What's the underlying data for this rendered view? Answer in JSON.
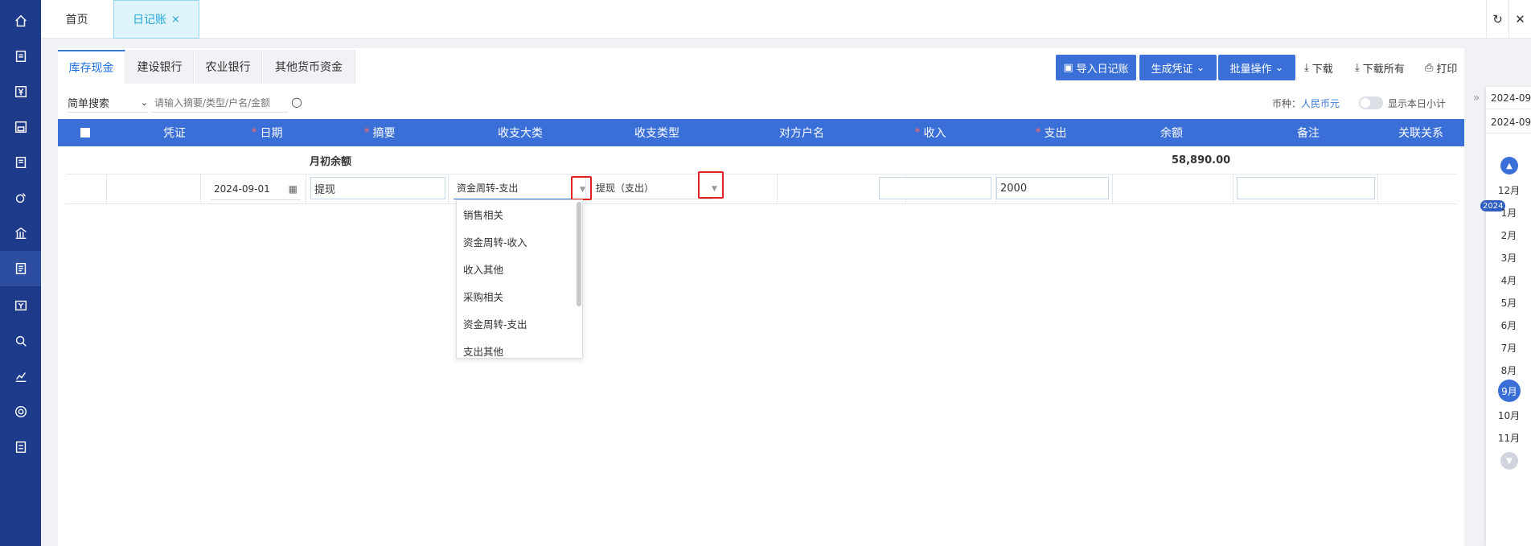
{
  "sidebar": {
    "icons": [
      "home-icon",
      "edit-icon",
      "yen-icon",
      "save-icon",
      "book-icon",
      "money-bag-icon",
      "building-icon",
      "ledger-icon",
      "invoice-icon",
      "search-user-icon",
      "chart-icon",
      "gear-icon",
      "report-icon"
    ]
  },
  "topbar": {
    "home": "首页",
    "diary": "日记账",
    "close": "×",
    "refresh": "↻",
    "close_all": "✕"
  },
  "bank_tabs": [
    "库存现金",
    "建设银行",
    "农业银行",
    "其他货币资金"
  ],
  "toolbar": {
    "import": "导入日记账",
    "voucher": "生成凭证",
    "batch": "批量操作",
    "download": "下载",
    "download_all": "下载所有",
    "print": "打印"
  },
  "search": {
    "mode": "简单搜索",
    "placeholder": "请输入摘要/类型/户名/金额"
  },
  "currency": {
    "label": "币种：",
    "value": "人民币元"
  },
  "toggle_label": "显示本日小计",
  "columns": [
    "凭证",
    "日期",
    "摘要",
    "收支大类",
    "收支类型",
    "对方户名",
    "收入",
    "支出",
    "余额",
    "备注",
    "关联关系"
  ],
  "required_mark": "*",
  "opening_row": {
    "label": "月初余额",
    "balance": "58,890.00"
  },
  "edit_row": {
    "date": "2024-09-01",
    "summary": "提现",
    "category": "资金周转-支出",
    "type": "提现（支出）",
    "counterparty": "",
    "income": "",
    "expense": "2000",
    "note": ""
  },
  "dropdown_options": [
    "销售相关",
    "资金周转-收入",
    "收入其他",
    "采购相关",
    "资金周转-支出",
    "支出其他"
  ],
  "right_panel": {
    "year_from": "2024-09",
    "year_to": "2024-09",
    "months": [
      "12月",
      "1月",
      "2月",
      "3月",
      "4月",
      "5月",
      "6月",
      "7月",
      "8月",
      "9月",
      "10月",
      "11月"
    ],
    "year_badge": "2024",
    "active_month": "9月"
  }
}
